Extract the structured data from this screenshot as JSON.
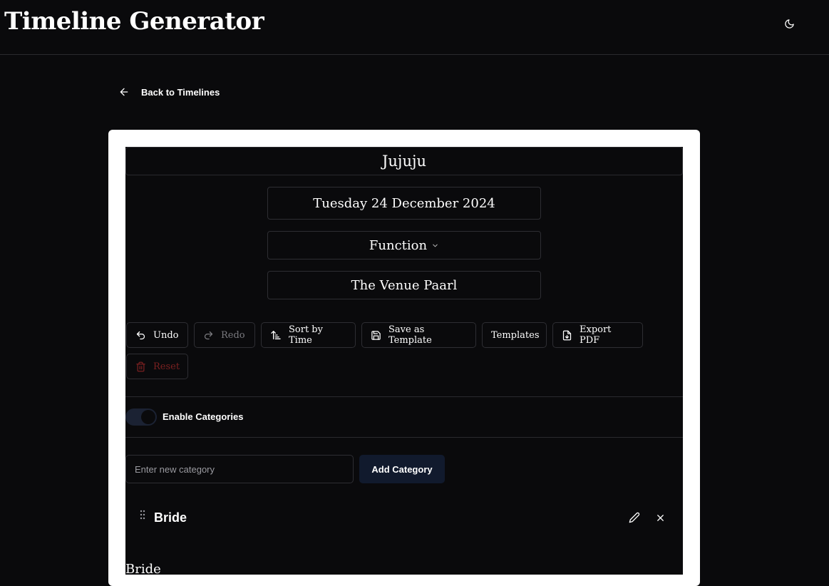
{
  "header": {
    "title": "Timeline Generator",
    "theme_icon": "moon-icon"
  },
  "nav": {
    "back_label": "Back to Timelines"
  },
  "timeline": {
    "name": "Jujuju",
    "date": "Tuesday 24 December 2024",
    "function": "Function",
    "venue": "The Venue Paarl"
  },
  "toolbar": {
    "undo": "Undo",
    "redo": "Redo",
    "sort": "Sort by Time",
    "save_template": "Save as Template",
    "templates": "Templates",
    "export_pdf": "Export PDF",
    "reset": "Reset"
  },
  "categories": {
    "toggle_label": "Enable Categories",
    "enabled": true,
    "input_placeholder": "Enter new category",
    "input_value": "",
    "add_button": "Add Category",
    "items": [
      {
        "name": "Bride"
      }
    ],
    "section_heading": "Bride"
  },
  "colors": {
    "background": "#0a0a0c",
    "card": "#ffffff",
    "border": "#2e2e33",
    "accent_button": "#111a2d",
    "danger": "#7a2020",
    "disabled": "#7a7a7f"
  }
}
